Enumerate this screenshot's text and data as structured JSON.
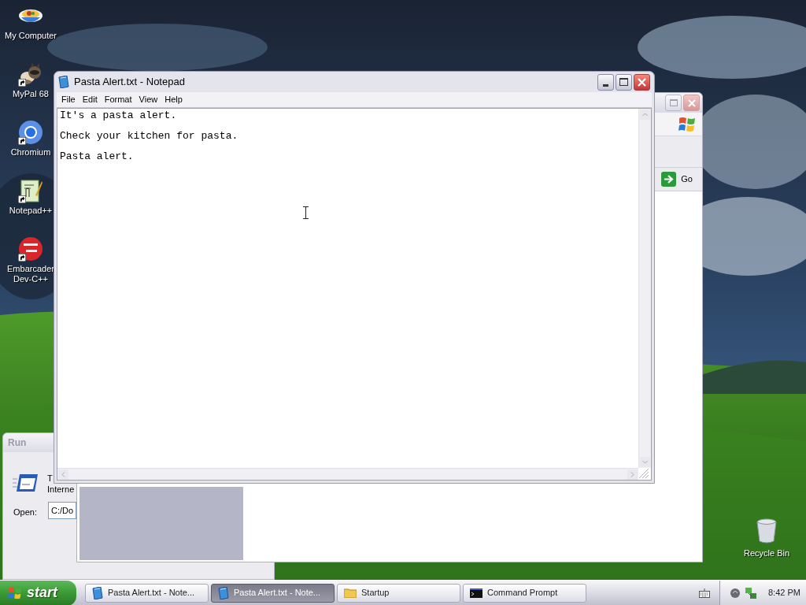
{
  "desktop_icons": [
    {
      "label": "My Computer",
      "kind": "bowl",
      "shortcut": false
    },
    {
      "label": "MyPal 68",
      "kind": "raccoon",
      "shortcut": true
    },
    {
      "label": "Chromium",
      "kind": "chromium",
      "shortcut": true
    },
    {
      "label": "Notepad++",
      "kind": "notepadpp",
      "shortcut": true
    },
    {
      "label": "Embarcader\nDev-C++",
      "kind": "devcpp",
      "shortcut": true
    }
  ],
  "recycle_bin": {
    "label": "Recycle Bin"
  },
  "run_dialog": {
    "title": "Run",
    "description": [
      "T",
      "Interne"
    ],
    "open_label": "Open:",
    "open_value": "C:/Do"
  },
  "back_window": {
    "go_label": "Go"
  },
  "notepad": {
    "title": "Pasta Alert.txt - Notepad",
    "menu": [
      "File",
      "Edit",
      "Format",
      "View",
      "Help"
    ],
    "lines": [
      "It's a pasta alert.",
      "Check your kitchen for pasta.",
      "Pasta alert."
    ]
  },
  "taskbar": {
    "start_label": "start",
    "buttons": [
      {
        "label": "Pasta Alert.txt - Note...",
        "kind": "notepad",
        "selected": false
      },
      {
        "label": "Pasta Alert.txt - Note...",
        "kind": "notepad",
        "selected": true
      },
      {
        "label": "Startup",
        "kind": "folder",
        "selected": false
      },
      {
        "label": "Command Prompt",
        "kind": "console",
        "selected": false
      }
    ],
    "clock": "8:42 PM"
  }
}
